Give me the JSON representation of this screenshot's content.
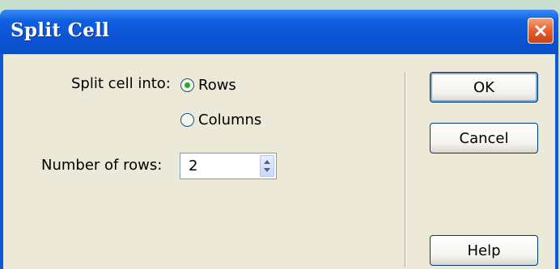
{
  "dialog": {
    "title": "Split Cell",
    "split_label": "Split cell into:",
    "options": [
      {
        "label": "Rows",
        "checked": true
      },
      {
        "label": "Columns",
        "checked": false
      }
    ],
    "rows_label": "Number of rows:",
    "rows_value": "2",
    "buttons": {
      "ok": "OK",
      "cancel": "Cancel",
      "help": "Help"
    }
  },
  "icons": {
    "close": "close-icon",
    "spin_up": "spin-up-icon",
    "spin_down": "spin-down-icon"
  },
  "colors": {
    "titlebar": "#0b5ad8",
    "client": "#ece9d8",
    "close_button": "#e55e2f",
    "radio_dot": "#2fa13a"
  }
}
